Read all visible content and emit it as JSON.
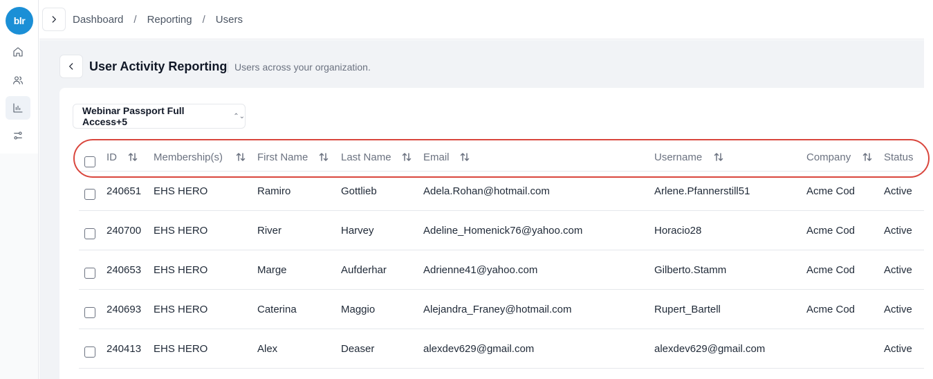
{
  "logo": {
    "text": "blr"
  },
  "sidebar": {
    "items": [
      {
        "name": "home",
        "icon": "home-icon",
        "active": false
      },
      {
        "name": "users",
        "icon": "users-icon",
        "active": false
      },
      {
        "name": "reporting",
        "icon": "bar-chart-icon",
        "active": true
      },
      {
        "name": "settings",
        "icon": "sliders-icon",
        "active": false
      }
    ]
  },
  "breadcrumb": [
    "Dashboard",
    "Reporting",
    "Users"
  ],
  "breadcrumb_separator": "/",
  "page": {
    "title": "User Activity Reporting",
    "subtitle": "Users across your organization."
  },
  "filter": {
    "label": "Webinar Passport Full Access+5"
  },
  "table": {
    "columns": [
      "ID",
      "Membership(s)",
      "First Name",
      "Last Name",
      "Email",
      "Username",
      "Company",
      "Status"
    ],
    "rows": [
      {
        "id": "240651",
        "membership": "EHS HERO",
        "first": "Ramiro",
        "last": "Gottlieb",
        "email": "Adela.Rohan@hotmail.com",
        "username": "Arlene.Pfannerstill51",
        "company": "Acme Cod",
        "status": "Active"
      },
      {
        "id": "240700",
        "membership": "EHS HERO",
        "first": "River",
        "last": "Harvey",
        "email": "Adeline_Homenick76@yahoo.com",
        "username": "Horacio28",
        "company": "Acme Cod",
        "status": "Active"
      },
      {
        "id": "240653",
        "membership": "EHS HERO",
        "first": "Marge",
        "last": "Aufderhar",
        "email": "Adrienne41@yahoo.com",
        "username": "Gilberto.Stamm",
        "company": "Acme Cod",
        "status": "Active"
      },
      {
        "id": "240693",
        "membership": "EHS HERO",
        "first": "Caterina",
        "last": "Maggio",
        "email": "Alejandra_Franey@hotmail.com",
        "username": "Rupert_Bartell",
        "company": "Acme Cod",
        "status": "Active"
      },
      {
        "id": "240413",
        "membership": "EHS HERO",
        "first": "Alex",
        "last": "Deaser",
        "email": "alexdev629@gmail.com",
        "username": "alexdev629@gmail.com",
        "company": "",
        "status": "Active"
      }
    ]
  }
}
